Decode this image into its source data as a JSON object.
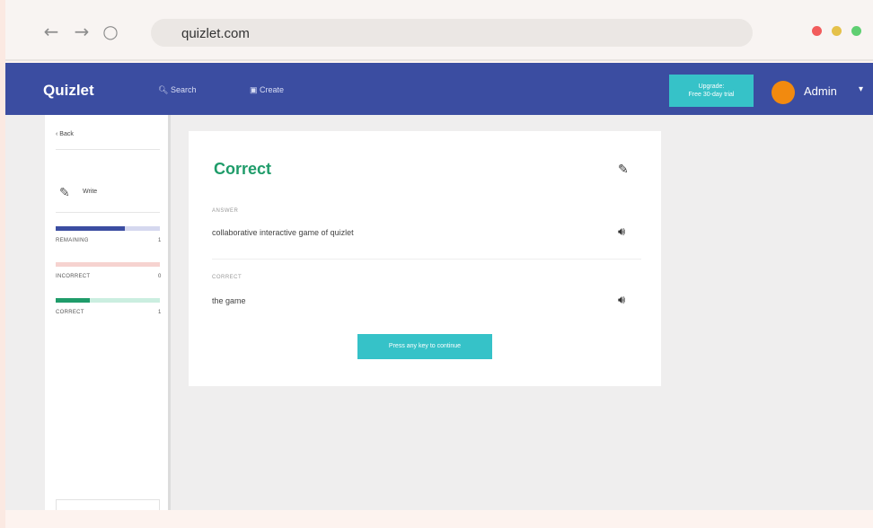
{
  "browser": {
    "url": "quizlet.com",
    "nav": {
      "back": "←",
      "forward": "→",
      "reload": "○"
    },
    "window_dots": [
      "#f25c5c",
      "#e5c14a",
      "#5fcf72"
    ]
  },
  "header": {
    "logo": "Quizlet",
    "search_label": "Search",
    "create_label": "Create",
    "upgrade_line1": "Upgrade:",
    "upgrade_line2": "Free 30-day trial",
    "user_name": "Admin",
    "caret": "▾"
  },
  "sidebar": {
    "back_label": "‹ Back",
    "mode_label": "Write",
    "progress": [
      {
        "label": "REMAINING",
        "count": "1",
        "fraction": 0.66,
        "fill_color": "#3b4da1",
        "track_color": "#d5d8ef"
      },
      {
        "label": "INCORRECT",
        "count": "0",
        "fraction": 0.0,
        "fill_color": "#e57373",
        "track_color": "#f6d3d0"
      },
      {
        "label": "CORRECT",
        "count": "1",
        "fraction": 0.33,
        "fill_color": "#1f9c6a",
        "track_color": "#cbeee0"
      }
    ]
  },
  "card": {
    "title": "Correct",
    "answer_label": "ANSWER",
    "answer_text": "collaborative interactive game of quizlet",
    "correct_label": "CORRECT",
    "correct_text": "the game",
    "continue_button": "Press any key to continue"
  },
  "colors": {
    "brand_header": "#3b4da1",
    "accent_teal": "#36c2c8",
    "correct_green": "#1f9c6a",
    "avatar_orange": "#f28a0f"
  }
}
